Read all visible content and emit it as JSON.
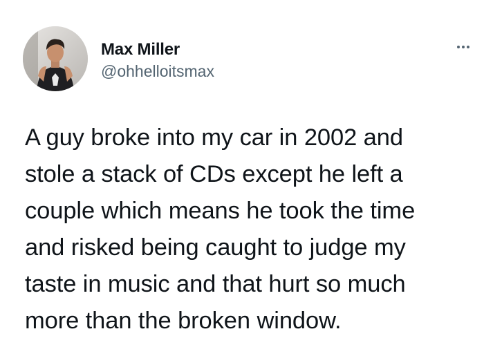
{
  "author": {
    "display_name": "Max Miller",
    "handle": "@ohhelloitsmax",
    "avatar_icon": "profile-photo"
  },
  "more_icon": "more-options-icon",
  "tweet": {
    "lines": [
      "A guy broke into my car in 2002 and",
      "stole a stack of CDs except he left a",
      "couple which means he took the time",
      "and risked being caught to judge my",
      "taste in music and that hurt so much",
      "more than the broken window."
    ]
  },
  "colors": {
    "text": "#0f1419",
    "secondary_text": "#536471",
    "background": "#ffffff"
  }
}
